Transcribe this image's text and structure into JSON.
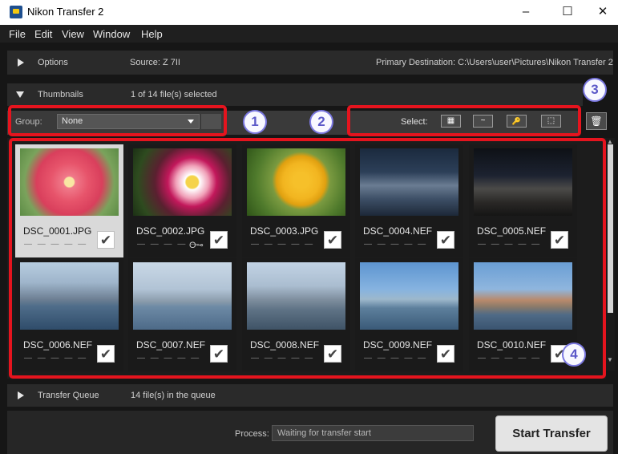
{
  "window": {
    "title": "Nikon Transfer 2",
    "minimize": "–",
    "maximize": "☐",
    "close": "✕"
  },
  "menu": [
    "File",
    "Edit",
    "View",
    "Window",
    "Help"
  ],
  "options": {
    "label": "Options",
    "source": "Source: Z 7II",
    "destination": "Primary Destination: C:\\Users\\user\\Pictures\\Nikon Transfer 2"
  },
  "thumbnails": {
    "label": "Thumbnails",
    "status": "1 of 14 file(s) selected"
  },
  "group": {
    "label": "Group:",
    "value": "None"
  },
  "select": {
    "label": "Select:"
  },
  "icons": {
    "trash": "🗑",
    "select_grid": "▦",
    "select_new": "~",
    "select_protected": "🔑",
    "select_none": "⬚"
  },
  "files": [
    {
      "name": "DSC_0001.JPG",
      "selected": true,
      "protected": false,
      "checked": true
    },
    {
      "name": "DSC_0002.JPG",
      "selected": false,
      "protected": true,
      "checked": true
    },
    {
      "name": "DSC_0003.JPG",
      "selected": false,
      "protected": false,
      "checked": true
    },
    {
      "name": "DSC_0004.NEF",
      "selected": false,
      "protected": false,
      "checked": true
    },
    {
      "name": "DSC_0005.NEF",
      "selected": false,
      "protected": false,
      "checked": true
    },
    {
      "name": "DSC_0006.NEF",
      "selected": false,
      "protected": false,
      "checked": true
    },
    {
      "name": "DSC_0007.NEF",
      "selected": false,
      "protected": false,
      "checked": true
    },
    {
      "name": "DSC_0008.NEF",
      "selected": false,
      "protected": false,
      "checked": true
    },
    {
      "name": "DSC_0009.NEF",
      "selected": false,
      "protected": false,
      "checked": true
    },
    {
      "name": "DSC_0010.NEF",
      "selected": false,
      "protected": false,
      "checked": true
    }
  ],
  "dashes": "— — — — —",
  "transfer_queue": {
    "label": "Transfer Queue",
    "status": "14 file(s) in the queue"
  },
  "process": {
    "label": "Process:",
    "value": "Waiting for transfer start"
  },
  "start_button": "Start Transfer",
  "callouts": [
    "1",
    "2",
    "3",
    "4"
  ],
  "colors": {
    "highlight": "#e5141e",
    "badge": "#7b78e0",
    "panel": "#2a2a2a"
  }
}
